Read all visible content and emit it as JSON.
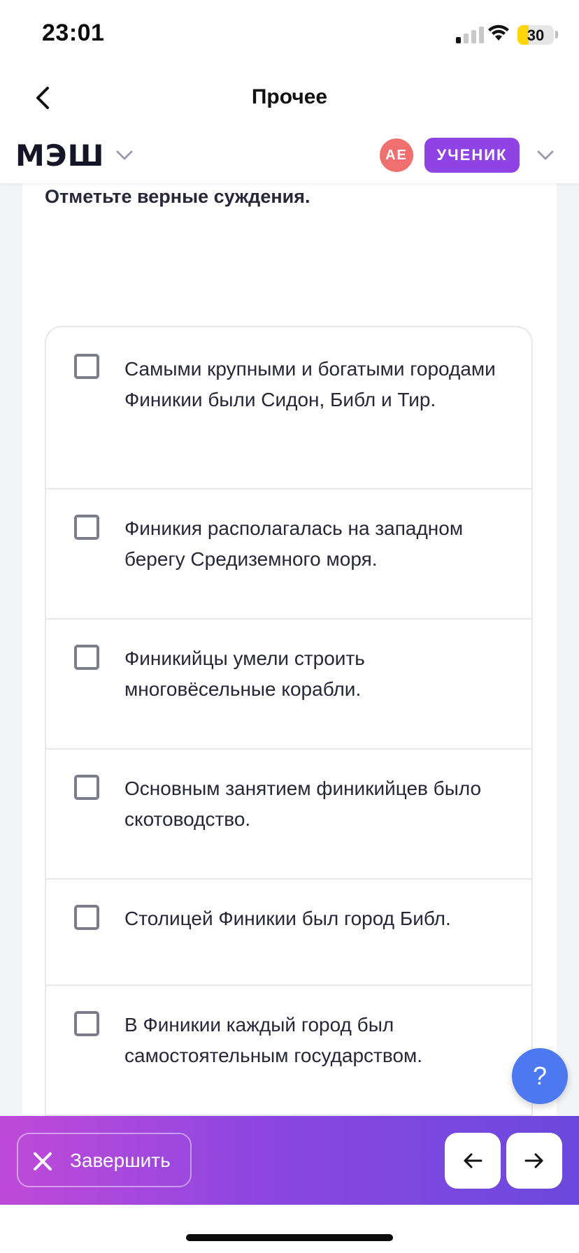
{
  "status_bar": {
    "time": "23:01",
    "battery": "30",
    "battery_level": 0.3
  },
  "nav": {
    "title": "Прочее"
  },
  "header": {
    "logo": "МЭШ",
    "avatar_initials": "АЕ",
    "role": "УЧЕНИК"
  },
  "question": {
    "prompt": "Отметьте верные суждения."
  },
  "options": [
    {
      "text": "Самыми крупными и богатыми городами Финикии были Сидон, Библ и Тир.",
      "checked": false
    },
    {
      "text": "Финикия располагалась на западном берегу Средиземного моря.",
      "checked": false
    },
    {
      "text": "Финикийцы умели строить многовёсельные корабли.",
      "checked": false
    },
    {
      "text": "Основным занятием финикийцев было скотоводство.",
      "checked": false
    },
    {
      "text": "Столицей Финикии был город Библ.",
      "checked": false
    },
    {
      "text": "В Финикии каждый город был самостоятельным государством.",
      "checked": false
    }
  ],
  "help": {
    "label": "?"
  },
  "footer": {
    "finish_label": "Завершить"
  },
  "icons": [
    "back-chevron-icon",
    "chevron-down-icon",
    "signal-icon",
    "wifi-icon",
    "battery-icon",
    "close-icon",
    "arrow-left-icon",
    "arrow-right-icon"
  ],
  "colors": {
    "accent": "#8f43e4",
    "avatar": "#f0706f",
    "help": "#4c78f0",
    "battery": "#ffd60a"
  }
}
